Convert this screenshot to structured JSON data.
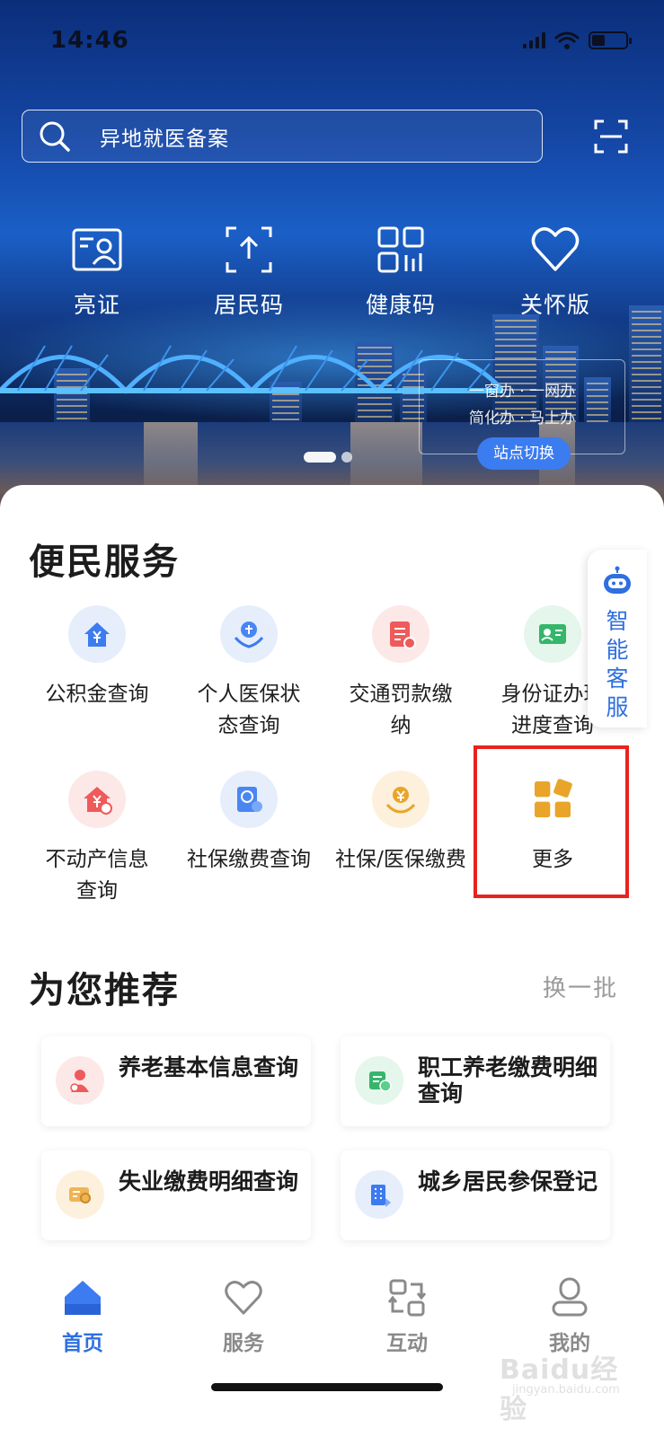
{
  "status_bar": {
    "time": "14:46"
  },
  "search": {
    "placeholder": "异地就医备案"
  },
  "quick_actions": [
    {
      "label": "亮证",
      "icon": "id-card-icon"
    },
    {
      "label": "居民码",
      "icon": "upload-code-icon"
    },
    {
      "label": "健康码",
      "icon": "health-code-icon"
    },
    {
      "label": "关怀版",
      "icon": "heart-icon"
    }
  ],
  "banner": {
    "slogan_line1": "一窗办 · 一网办",
    "slogan_line2": "简化办 · 马上办",
    "station_button": "站点切换",
    "page_indicator": {
      "current": 1,
      "total": 2
    }
  },
  "convenience": {
    "title": "便民服务",
    "items": [
      {
        "label": "公积金查询",
        "icon": "house-yuan-icon"
      },
      {
        "label": "个人医保状态查询",
        "icon": "insurance-hands-icon"
      },
      {
        "label": "交通罚款缴纳",
        "icon": "fine-receipt-icon"
      },
      {
        "label": "身份证办理进度查询",
        "icon": "id-card-progress-icon"
      },
      {
        "label": "不动产信息查询",
        "icon": "property-icon"
      },
      {
        "label": "社保缴费查询",
        "icon": "social-security-icon"
      },
      {
        "label": "社保/医保缴费",
        "icon": "payment-hand-icon"
      },
      {
        "label": "更多",
        "icon": "more-grid-icon"
      }
    ]
  },
  "assistant": {
    "label": "智能客服",
    "icon": "robot-icon"
  },
  "recommend": {
    "title": "为您推荐",
    "refresh_label": "换一批",
    "items": [
      {
        "label": "养老基本信息查询",
        "icon": "pension-icon"
      },
      {
        "label": "职工养老缴费明细查询",
        "icon": "worker-pension-icon"
      },
      {
        "label": "失业缴费明细查询",
        "icon": "unemployment-icon"
      },
      {
        "label": "城乡居民参保登记",
        "icon": "building-icon"
      }
    ]
  },
  "tabbar": {
    "items": [
      {
        "label": "首页",
        "active": true,
        "icon": "home-icon"
      },
      {
        "label": "服务",
        "active": false,
        "icon": "heart-outline-icon"
      },
      {
        "label": "互动",
        "active": false,
        "icon": "interact-icon"
      },
      {
        "label": "我的",
        "active": false,
        "icon": "person-icon"
      }
    ]
  },
  "watermark": {
    "brand": "Baidu经验",
    "domain": "jingyan.baidu.com"
  },
  "colors": {
    "accent": "#2f6fe0",
    "highlight_border": "#e8231f",
    "more_icon": "#e8a52a"
  }
}
